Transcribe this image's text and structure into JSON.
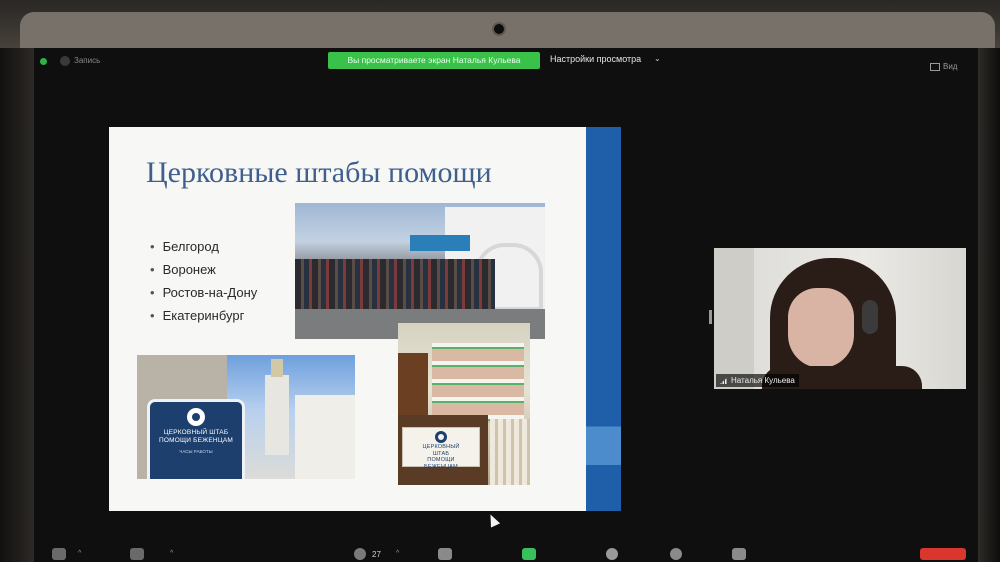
{
  "window": {
    "recording_label": "Запись",
    "share_banner": "Вы просматриваете экран Наталья Кульева",
    "view_settings": "Настройки просмотра",
    "view_button": "Вид"
  },
  "slide": {
    "title": "Церковные штабы помощи",
    "cities": [
      "Белгород",
      "Воронеж",
      "Ростов-на-Дону",
      "Екатеринбург"
    ],
    "sign_outdoor": {
      "line1": "ЦЕРКОВНЫЙ ШТАБ",
      "line2": "ПОМОЩИ БЕЖЕНЦАМ",
      "small": "ЧАСЫ РАБОТЫ"
    },
    "sign_indoor": {
      "line1": "ЦЕРКОВНЫЙ",
      "line2": "ШТАБ",
      "line3": "ПОМОЩИ",
      "line4": "БЕЖЕНЦАМ"
    }
  },
  "participant": {
    "name": "Наталья Кульева"
  },
  "toolbar": {
    "participants_count": "27"
  },
  "colors": {
    "share_banner": "#3ac149",
    "slide_accent": "#1f5ea8",
    "title_text": "#3f5f8c",
    "end_button": "#d9362d"
  }
}
